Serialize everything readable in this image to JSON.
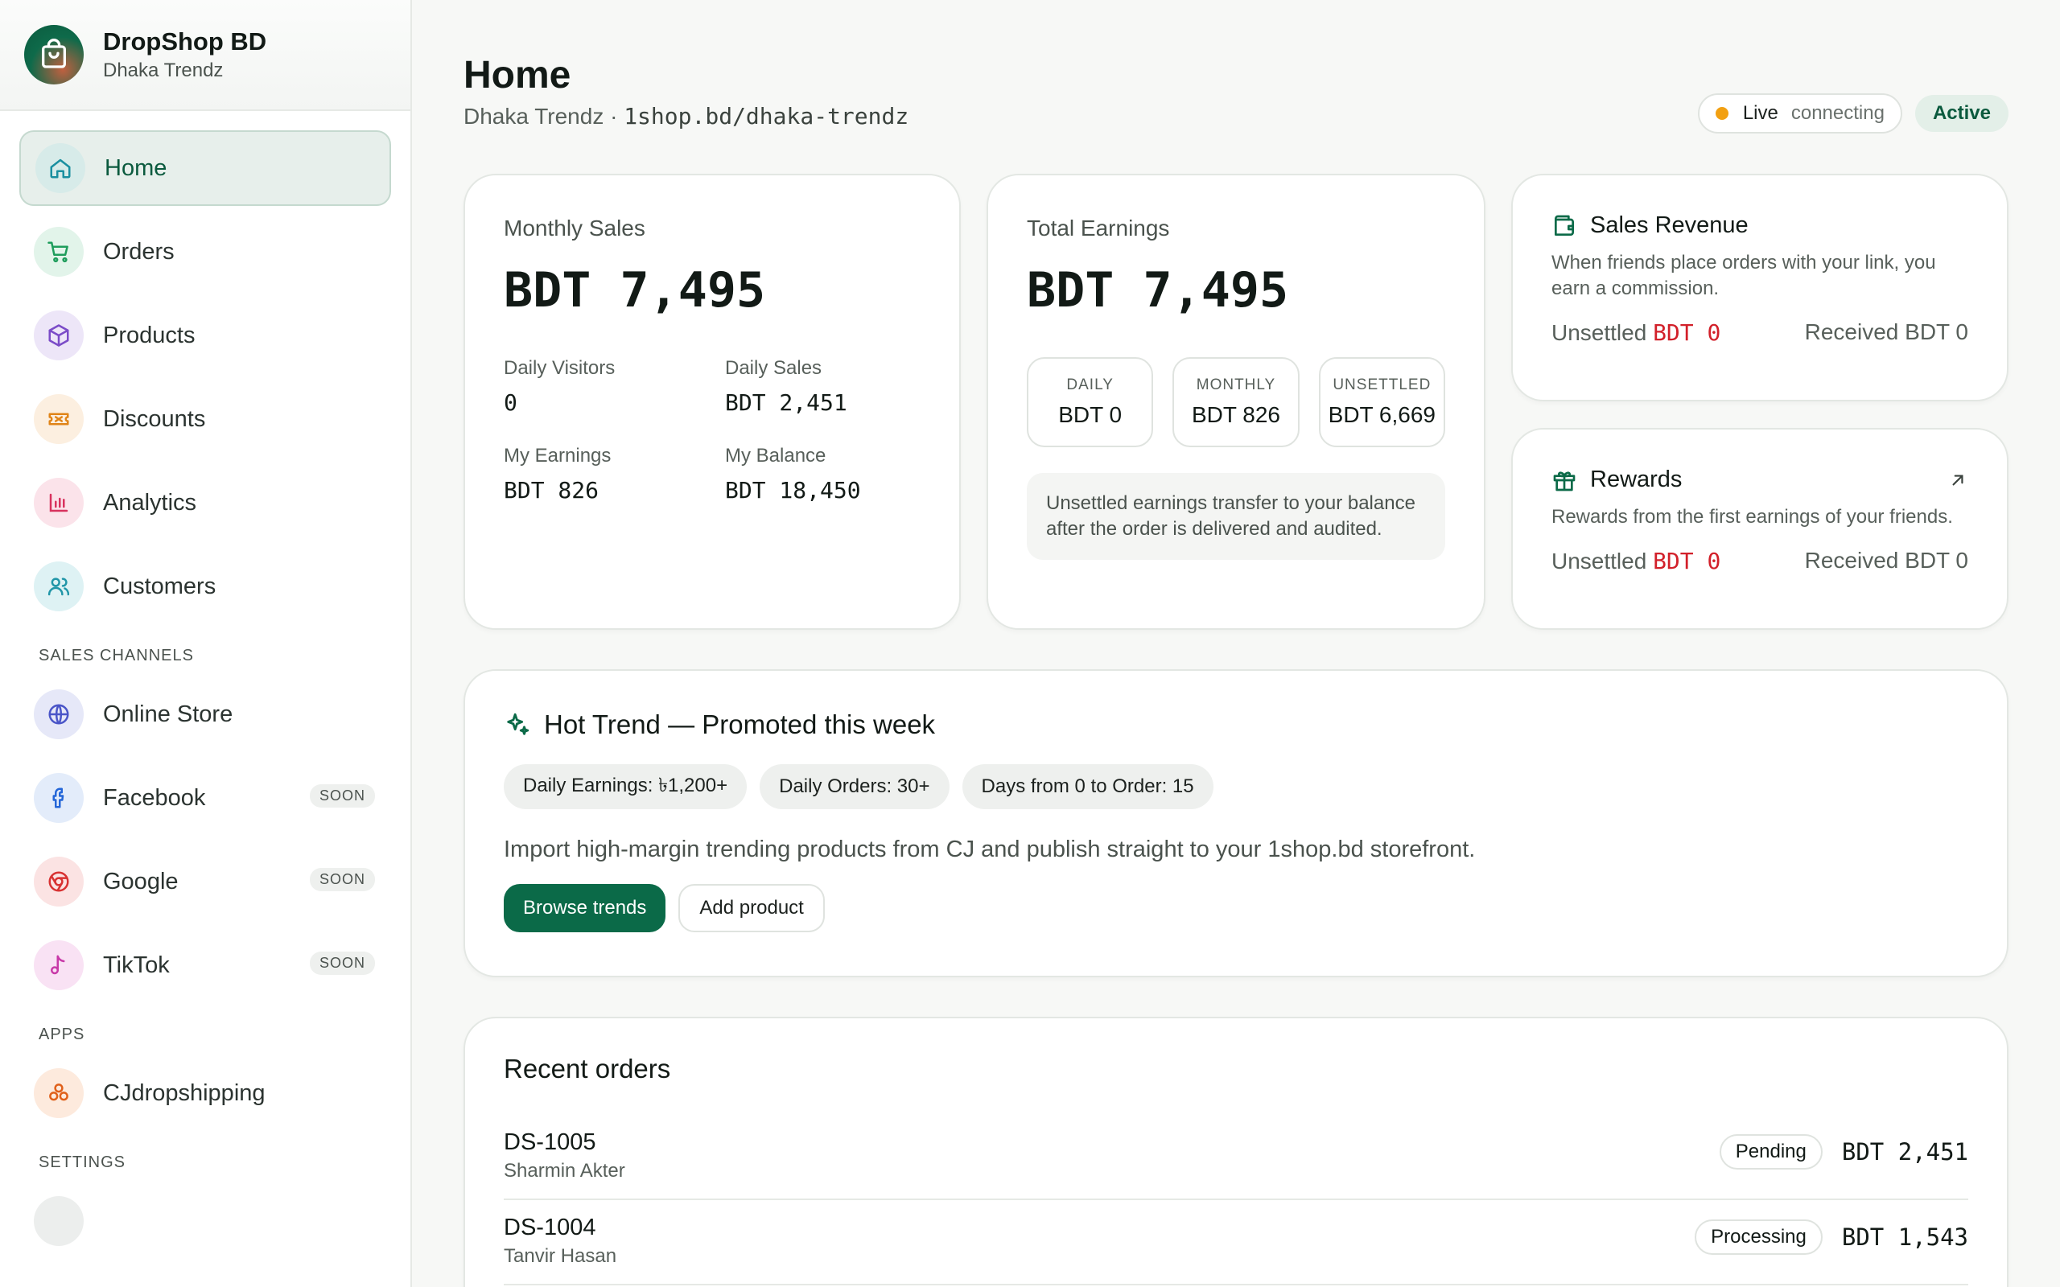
{
  "brand": {
    "name": "DropShop BD",
    "store": "Dhaka Trendz"
  },
  "nav": {
    "items": [
      {
        "label": "Home",
        "icon": "home-icon",
        "active": true
      },
      {
        "label": "Orders",
        "icon": "cart-icon"
      },
      {
        "label": "Products",
        "icon": "box-icon"
      },
      {
        "label": "Discounts",
        "icon": "ticket-icon"
      },
      {
        "label": "Analytics",
        "icon": "bar-chart-icon"
      },
      {
        "label": "Customers",
        "icon": "users-icon"
      }
    ],
    "sales_channels_title": "SALES CHANNELS",
    "channels": [
      {
        "label": "Online Store",
        "icon": "globe-icon"
      },
      {
        "label": "Facebook",
        "icon": "facebook-icon",
        "badge": "SOON"
      },
      {
        "label": "Google",
        "icon": "google-icon",
        "badge": "SOON"
      },
      {
        "label": "TikTok",
        "icon": "tiktok-icon",
        "badge": "SOON"
      }
    ],
    "apps_title": "APPS",
    "apps": [
      {
        "label": "CJdropshipping",
        "icon": "cj-icon"
      }
    ],
    "settings_title": "SETTINGS"
  },
  "header": {
    "title": "Home",
    "store_name": "Dhaka Trendz ·",
    "store_url": "1shop.bd/dhaka-trendz",
    "live_label": "Live",
    "live_status": "connecting",
    "active_label": "Active"
  },
  "monthly_sales": {
    "label": "Monthly Sales",
    "amount": "BDT 7,495",
    "daily_visitors_label": "Daily Visitors",
    "daily_visitors": "0",
    "daily_sales_label": "Daily Sales",
    "daily_sales": "BDT 2,451",
    "my_earnings_label": "My Earnings",
    "my_earnings": "BDT 826",
    "my_balance_label": "My Balance",
    "my_balance": "BDT 18,450"
  },
  "total_earnings": {
    "label": "Total Earnings",
    "amount": "BDT 7,495",
    "daily_label": "DAILY",
    "daily": "BDT 0",
    "monthly_label": "MONTHLY",
    "monthly": "BDT 826",
    "unsettled_label": "UNSETTLED",
    "unsettled": "BDT 6,669",
    "note": "Unsettled earnings transfer to your balance after the order is delivered and audited."
  },
  "sales_revenue": {
    "title": "Sales Revenue",
    "desc": "When friends place orders with your link, you earn a commission.",
    "unsettled_label": "Unsettled",
    "unsettled_value": "BDT 0",
    "received": "Received BDT 0"
  },
  "rewards": {
    "title": "Rewards",
    "desc": "Rewards from the first earnings of your friends.",
    "unsettled_label": "Unsettled",
    "unsettled_value": "BDT 0",
    "received": "Received BDT 0"
  },
  "hot_trend": {
    "title": "Hot Trend — Promoted this week",
    "chips": [
      "Daily Earnings: ৳1,200+",
      "Daily Orders: 30+",
      "Days from 0 to Order: 15"
    ],
    "desc": "Import high-margin trending products from CJ and publish straight to your 1shop.bd storefront.",
    "primary_button": "Browse trends",
    "secondary_button": "Add product"
  },
  "recent_orders": {
    "title": "Recent orders",
    "rows": [
      {
        "id": "DS-1005",
        "customer": "Sharmin Akter",
        "status": "Pending",
        "amount": "BDT 2,451"
      },
      {
        "id": "DS-1004",
        "customer": "Tanvir Hasan",
        "status": "Processing",
        "amount": "BDT 1,543"
      }
    ]
  },
  "colors": {
    "primary": "#0b6a48",
    "accent_red": "#d2202a",
    "live_dot": "#f2a012"
  }
}
